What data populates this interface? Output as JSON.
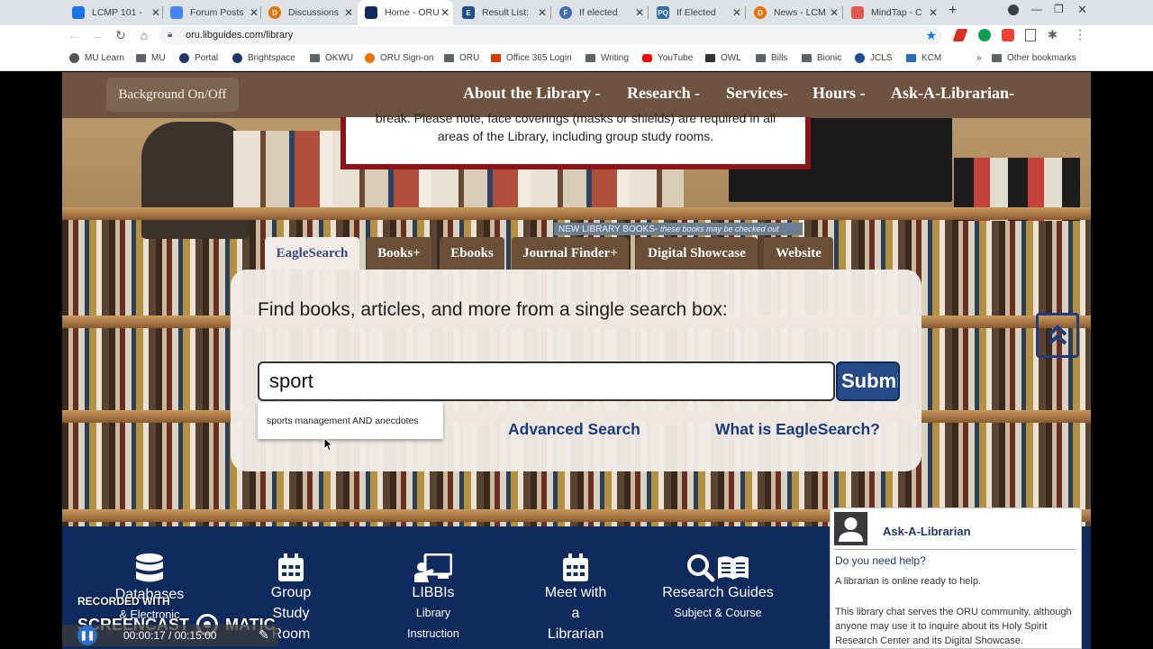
{
  "browser": {
    "tabs": [
      {
        "title": "LCMP 101 -",
        "favcolor": "#1a73e8"
      },
      {
        "title": "Forum Posts",
        "favcolor": "#4285f4"
      },
      {
        "title": "Discussions",
        "favcolor": "#e37400"
      },
      {
        "title": "Home - ORU",
        "favcolor": "#0f2b5e"
      },
      {
        "title": "Result List:",
        "favcolor": "#1f4e8c"
      },
      {
        "title": "If elected",
        "favcolor": "#3f6eb5"
      },
      {
        "title": "If Elected",
        "favcolor": "#2f6fb0"
      },
      {
        "title": "News - LCM",
        "favcolor": "#e37400"
      },
      {
        "title": "MindTap - C",
        "favcolor": "#e2584c"
      }
    ],
    "url": "oru.libguides.com/library",
    "bookmarks": [
      "MU Learn",
      "MU",
      "Portal",
      "Brightspace",
      "OKWU",
      "ORU Sign-on",
      "ORU",
      "Office 365 Login",
      "Writing",
      "YouTube",
      "OWL",
      "Bills",
      "Bionic",
      "JCLS",
      "KCM",
      "Other bookmarks"
    ]
  },
  "navbar": {
    "background_toggle": "Background On/Off",
    "items": [
      "About the Library -",
      "Research -",
      "Services-",
      "Hours -",
      "Ask-A-Librarian-"
    ]
  },
  "notice": {
    "line1": "break. Please note, face coverings (masks or shields) are required in all",
    "line2": "areas of the Library, including group study rooms."
  },
  "new_books_sign": {
    "main": "NEW LIBRARY BOOKS-",
    "sub": "these books may be checked out"
  },
  "search": {
    "tabs": [
      "EagleSearch",
      "Books+",
      "Ebooks",
      "Journal Finder+",
      "Digital Showcase",
      "Website"
    ],
    "active_tab": "EagleSearch",
    "heading": "Find books, articles, and more from a single search box:",
    "query": "sport",
    "submit_label": "Submit",
    "suggestion": "sports management AND anecdotes",
    "advanced_link": "Advanced Search",
    "what_is_link": "What is EagleSearch?"
  },
  "footer": {
    "items": [
      {
        "big": "Databases",
        "small": "& Electronic"
      },
      {
        "big": "Group Study Room",
        "small": ""
      },
      {
        "big": "LIBBIs",
        "small": "Library Instruction"
      },
      {
        "big": "Meet with a Librarian",
        "small": ""
      },
      {
        "big": "Research Guides",
        "small": "Subject & Course"
      }
    ]
  },
  "chat": {
    "title": "Ask-A-Librarian",
    "question": "Do you need help?",
    "status": "A librarian is online ready to help.",
    "description": "This library chat serves the ORU community, although anyone may use it to inquire about its Holy Spirit Research Center and its Digital Showcase."
  },
  "overlay": {
    "recorded": "RECORDED WITH",
    "brand_left": "SCREENCAST",
    "brand_right": "MATIC",
    "timer": "00:00:17 / 00:15:00"
  },
  "colors": {
    "navbar": "#6e5440",
    "footer": "#0f2b5e",
    "link": "#1c3b7a",
    "submit": "#264a85"
  }
}
